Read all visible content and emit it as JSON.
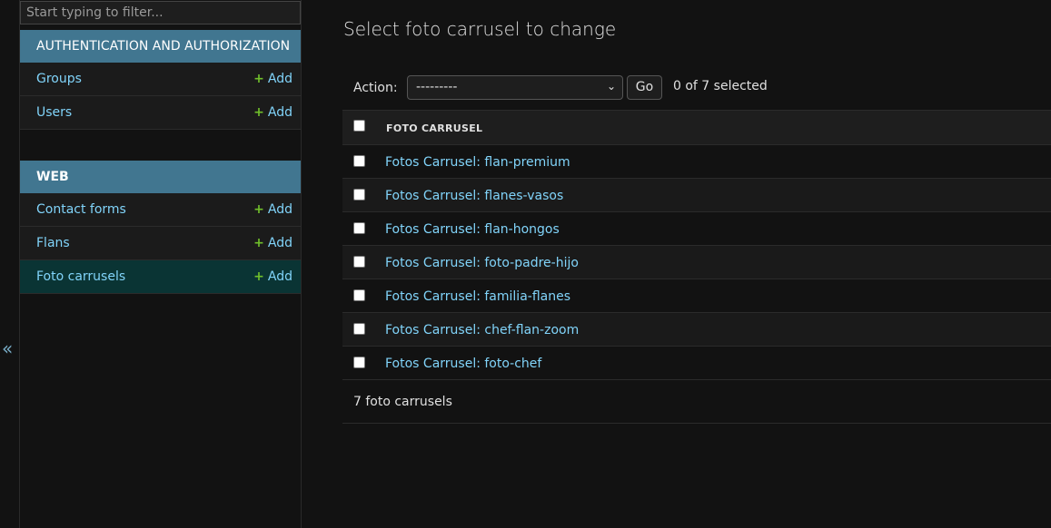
{
  "sidebar": {
    "filter_placeholder": "Start typing to filter...",
    "collapse_glyph": "«",
    "modules": [
      {
        "caption": "AUTHENTICATION AND AUTHORIZATION",
        "rows": [
          {
            "label": "Groups",
            "add": "Add"
          },
          {
            "label": "Users",
            "add": "Add"
          }
        ]
      },
      {
        "caption": "WEB",
        "rows": [
          {
            "label": "Contact forms",
            "add": "Add"
          },
          {
            "label": "Flans",
            "add": "Add"
          },
          {
            "label": "Foto carrusels",
            "add": "Add",
            "current": true
          }
        ]
      }
    ]
  },
  "content": {
    "title": "Select foto carrusel to change",
    "actions": {
      "label": "Action:",
      "selected_option": "---------",
      "go_label": "Go",
      "counter": "0 of 7 selected"
    },
    "table": {
      "column_header": "FOTO CARRUSEL",
      "rows": [
        "Fotos Carrusel: flan-premium",
        "Fotos Carrusel: flanes-vasos",
        "Fotos Carrusel: flan-hongos",
        "Fotos Carrusel: foto-padre-hijo",
        "Fotos Carrusel: familia-flanes",
        "Fotos Carrusel: chef-flan-zoom",
        "Fotos Carrusel: foto-chef"
      ]
    },
    "paginator": "7 foto carrusels"
  },
  "colors": {
    "module_caption_bg": "#417690",
    "link": "#81d4fa",
    "add_plus": "#70bf2b",
    "current_row_bg": "#0a3434"
  },
  "icons": {
    "add": "plus-icon",
    "collapse": "double-chevron-left-icon",
    "select_caret": "chevron-down-icon"
  }
}
